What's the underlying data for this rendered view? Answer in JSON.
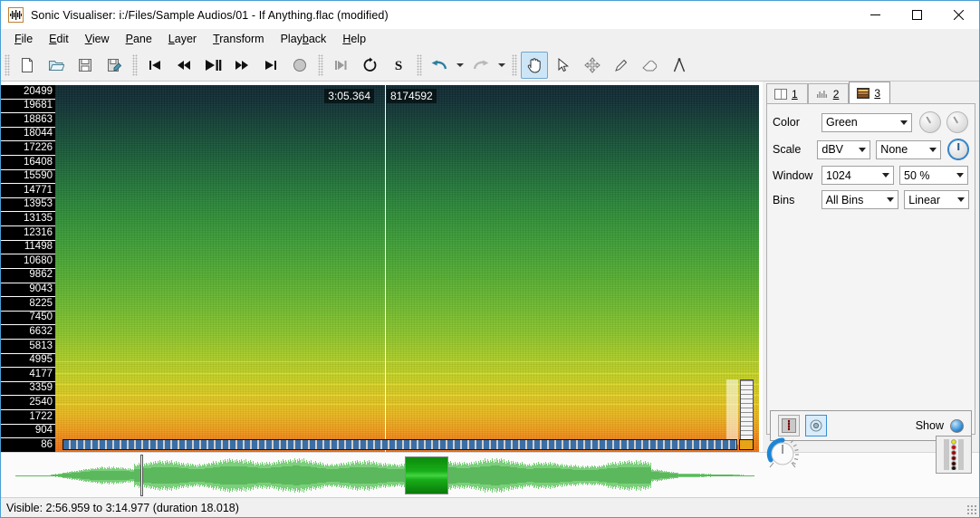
{
  "window": {
    "title": "Sonic Visualiser: i:/Files/Sample Audios/01 - If Anything.flac (modified)",
    "app_icon": "waveform-icon",
    "minimize": "—",
    "maximize": "☐",
    "close": "✕"
  },
  "menubar": [
    {
      "label": "File",
      "accel": "F"
    },
    {
      "label": "Edit",
      "accel": "E"
    },
    {
      "label": "View",
      "accel": "V"
    },
    {
      "label": "Pane",
      "accel": "P"
    },
    {
      "label": "Layer",
      "accel": "L"
    },
    {
      "label": "Transform",
      "accel": "T"
    },
    {
      "label": "Playback",
      "accel": "b"
    },
    {
      "label": "Help",
      "accel": "H"
    }
  ],
  "toolbar": {
    "groups": [
      [
        "new-file-icon",
        "open-folder-icon",
        "save-icon",
        "save-as-icon"
      ],
      [
        "rewind-start-icon",
        "rewind-icon",
        "play-pause-icon",
        "fast-forward-icon",
        "forward-end-icon",
        "record-icon"
      ],
      [
        "step-to-icon",
        "loop-icon",
        "solo-icon"
      ],
      [
        "undo-icon",
        "redo-icon"
      ],
      [
        "navigate-hand-icon",
        "select-arrow-icon",
        "edit-move-icon",
        "draw-pencil-icon",
        "erase-icon",
        "measure-icon"
      ]
    ],
    "active_tool": "navigate-hand-icon"
  },
  "spectrogram": {
    "playhead_time": "3:05.364",
    "playhead_frame": "8174592",
    "frequencies": [
      "20499",
      "19681",
      "18863",
      "18044",
      "17226",
      "16408",
      "15590",
      "14771",
      "13953",
      "13135",
      "12316",
      "11498",
      "10680",
      "9862",
      "9043",
      "8225",
      "7450",
      "6632",
      "5813",
      "4995",
      "4177",
      "3359",
      "2540",
      "1722",
      "904",
      "86"
    ]
  },
  "properties": {
    "tabs": [
      {
        "number": "1",
        "icon": "pane-icon"
      },
      {
        "number": "2",
        "icon": "waveform-layer-icon"
      },
      {
        "number": "3",
        "icon": "spectrogram-layer-icon"
      }
    ],
    "active_tab": "3",
    "rows": [
      {
        "label": "Color",
        "value": "Green"
      },
      {
        "label": "Scale",
        "value": "dBV",
        "value2": "None"
      },
      {
        "label": "Window",
        "value": "1024",
        "value2": "50 %"
      },
      {
        "label": "Bins",
        "value": "All Bins",
        "value2": "Linear"
      }
    ],
    "show_label": "Show",
    "show_enabled": true,
    "layer_buttons": [
      "colour-scale-icon",
      "visibility-icon"
    ]
  },
  "statusbar": {
    "text": "Visible: 2:56.959 to 3:14.977 (duration 18.018)"
  },
  "colors": {
    "accent": "#4a9ed4",
    "selection": "#18ad18",
    "waveform": "#5cb85c",
    "window_bg": "#f0f0f0"
  }
}
